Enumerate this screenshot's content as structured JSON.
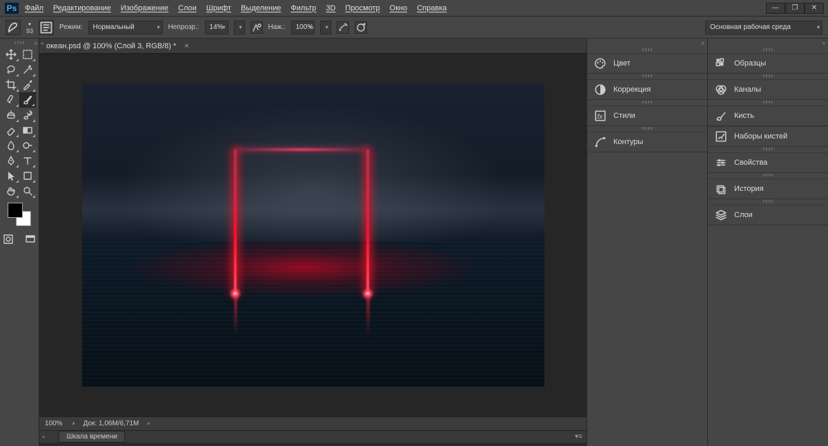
{
  "app": {
    "logo": "Ps"
  },
  "menu": {
    "file": "Файл",
    "edit": "Редактирование",
    "image": "Изображение",
    "layer": "Слои",
    "type": "Шрифт",
    "select": "Выделение",
    "filter": "Фильтр",
    "threeD": "3D",
    "view": "Просмотр",
    "window": "Окно",
    "help": "Справка"
  },
  "optbar": {
    "brush_size": "93",
    "mode_label": "Режим:",
    "mode_value": "Нормальный",
    "opacity_label": "Непрозр.:",
    "opacity_value": "14%",
    "flow_label": "Наж.:",
    "flow_value": "100%",
    "workspace": "Основная рабочая среда"
  },
  "document": {
    "tab_title": "океан.psd @ 100% (Слой 3, RGB/8) *",
    "zoom": "100%",
    "doc_size": "Док: 1,06M/6,71M"
  },
  "timeline": {
    "label": "Шкала времени"
  },
  "panels_left": {
    "color": "Цвет",
    "adjustments": "Коррекция",
    "styles": "Стили",
    "paths": "Контуры"
  },
  "panels_right": {
    "swatches": "Образцы",
    "channels": "Каналы",
    "brush": "Кисть",
    "brush_presets": "Наборы кистей",
    "properties": "Свойства",
    "history": "История",
    "layers": "Слои"
  }
}
